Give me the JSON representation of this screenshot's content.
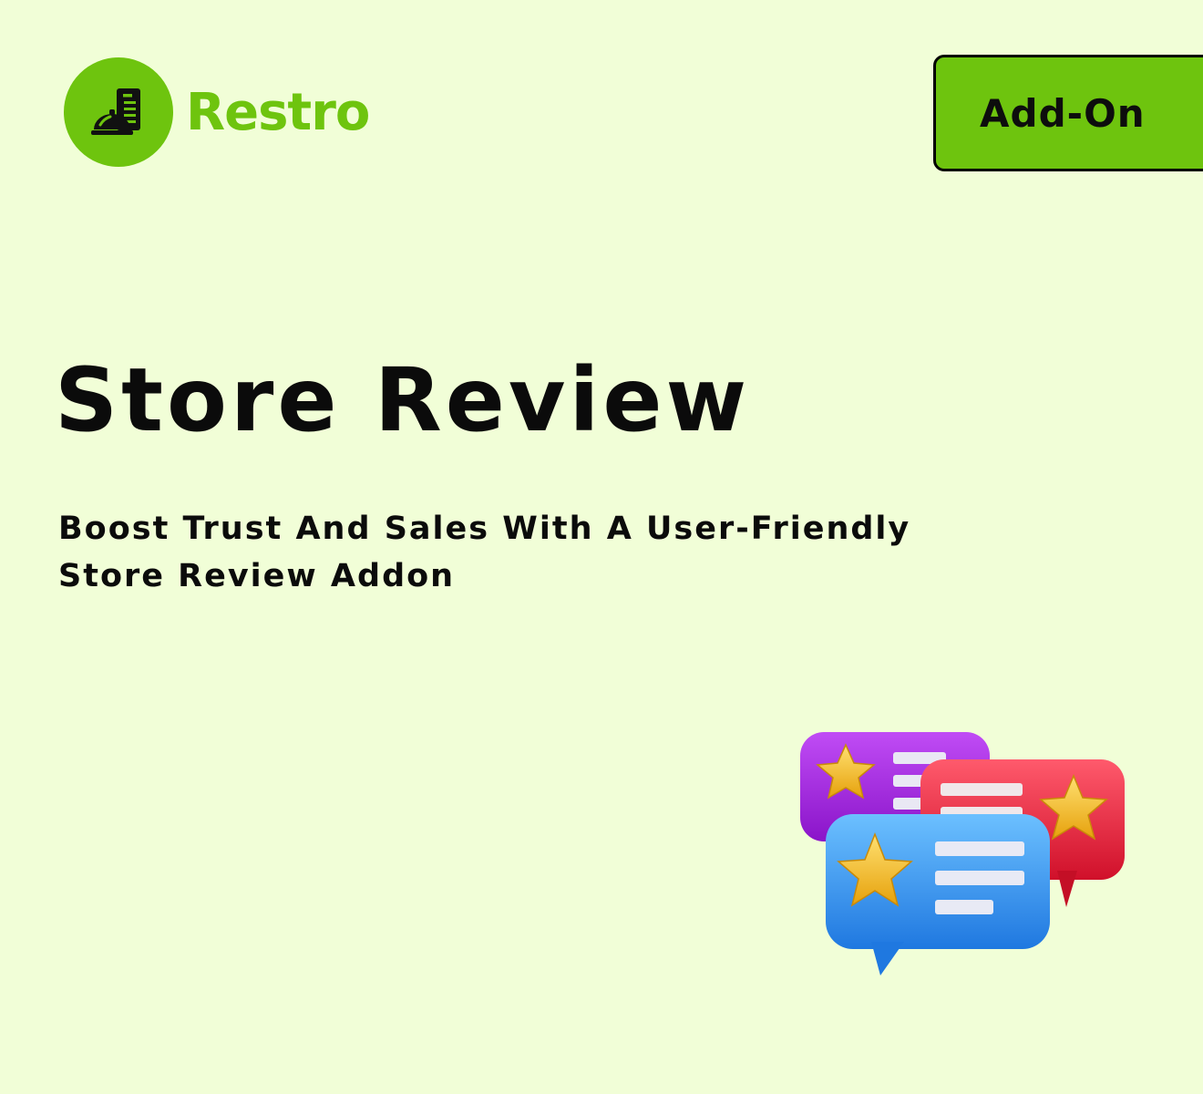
{
  "brand": {
    "name": "Restro",
    "color": "#6ec40e",
    "icon": "bell-menu-icon"
  },
  "badge": {
    "label": "Add-On"
  },
  "hero": {
    "title": "Store Review",
    "subtitle": "Boost Trust And Sales With A User-Friendly Store Review Addon"
  },
  "illustration": {
    "icon": "review-chat-bubbles-icon",
    "bubble_colors": [
      "#a21de0",
      "#e31d3a",
      "#2f8df0"
    ],
    "star_color": "#f3bf24"
  }
}
